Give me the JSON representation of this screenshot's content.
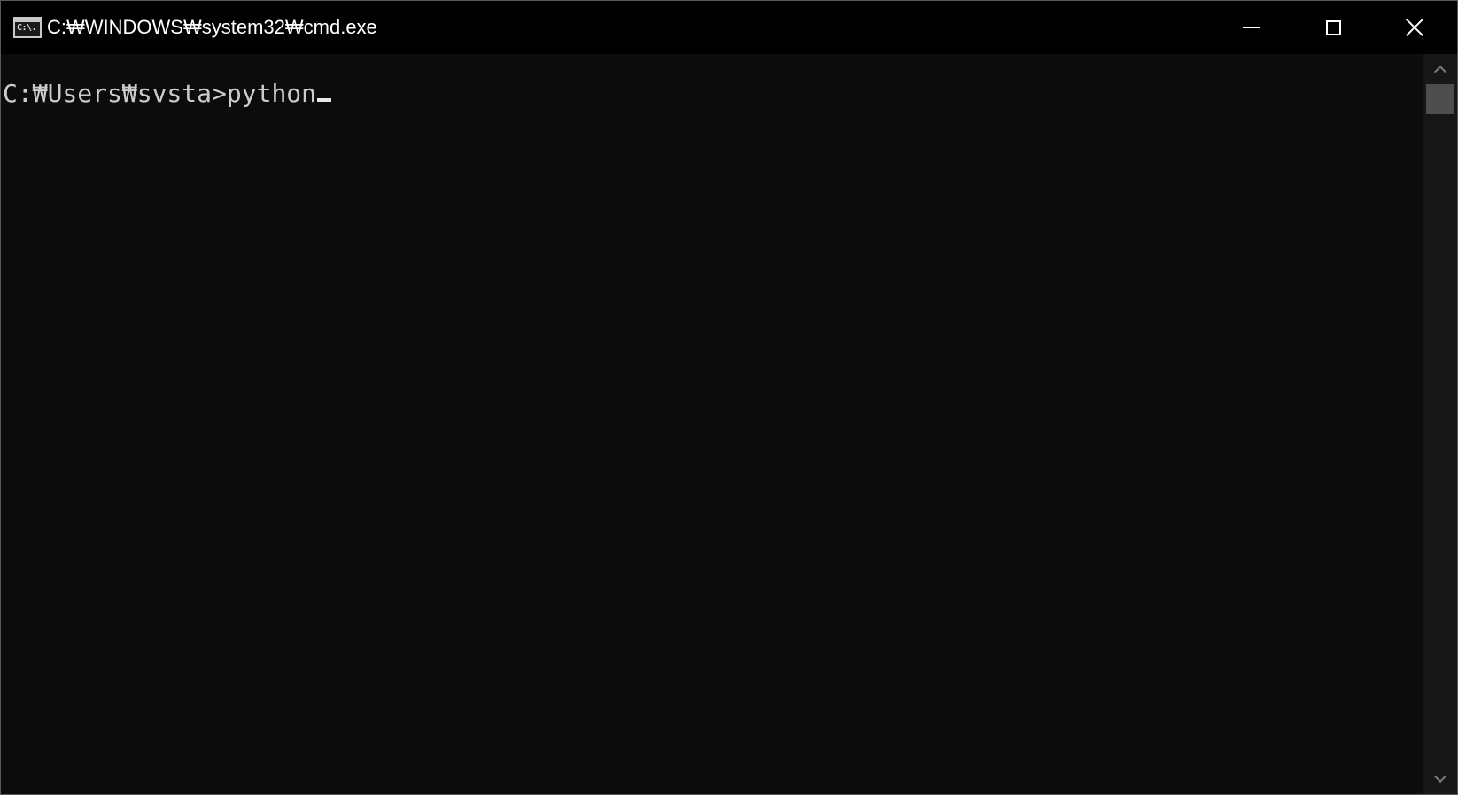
{
  "window": {
    "title": "C:₩WINDOWS₩system32₩cmd.exe",
    "icon_label": "C:\\.",
    "icon": "cmd-app-icon",
    "controls": {
      "minimize_icon": "minimize-icon",
      "maximize_icon": "maximize-icon",
      "close_icon": "close-icon"
    }
  },
  "console": {
    "prompt": "C:₩Users₩svsta>",
    "command": "python",
    "text_color": "#cccccc",
    "background": "#0c0c0c"
  },
  "scrollbar": {
    "up_icon": "chevron-up-icon",
    "down_icon": "chevron-down-icon",
    "position": 0
  }
}
